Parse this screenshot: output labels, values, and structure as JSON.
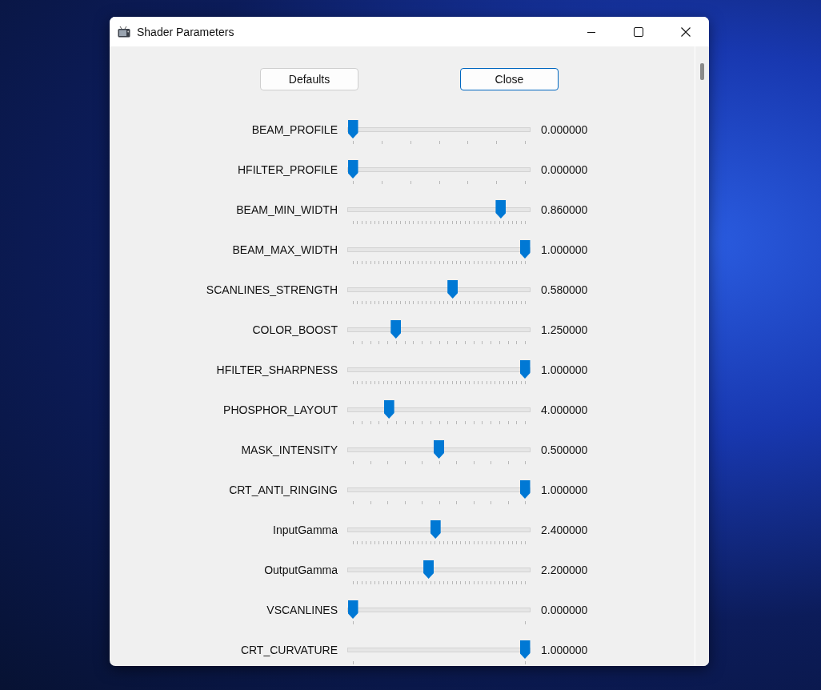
{
  "window": {
    "title": "Shader Parameters"
  },
  "buttons": [
    {
      "label": "Defaults",
      "focused": false
    },
    {
      "label": "Close",
      "focused": true
    }
  ],
  "parameters": [
    {
      "name": "BEAM_PROFILE",
      "level": 0,
      "kind": "sixths",
      "reading": "0.000000"
    },
    {
      "name": "HFILTER_PROFILE",
      "level": 0,
      "kind": "sixths",
      "reading": "0.000000"
    },
    {
      "name": "BEAM_MIN_WIDTH",
      "level": 0.86,
      "kind": "fine",
      "reading": "0.860000"
    },
    {
      "name": "BEAM_MAX_WIDTH",
      "level": 1,
      "kind": "fine",
      "reading": "1.000000"
    },
    {
      "name": "SCANLINES_STRENGTH",
      "level": 0.58,
      "kind": "fine",
      "reading": "0.580000"
    },
    {
      "name": "COLOR_BOOST",
      "level": 0.25,
      "kind": "twentieths",
      "reading": "1.250000"
    },
    {
      "name": "HFILTER_SHARPNESS",
      "level": 1,
      "kind": "fine",
      "reading": "1.000000"
    },
    {
      "name": "PHOSPHOR_LAYOUT",
      "level": 0.21,
      "kind": "twentieths",
      "reading": "4.000000"
    },
    {
      "name": "MASK_INTENSITY",
      "level": 0.5,
      "kind": "tenths",
      "reading": "0.500000"
    },
    {
      "name": "CRT_ANTI_RINGING",
      "level": 1,
      "kind": "tenths",
      "reading": "1.000000"
    },
    {
      "name": "InputGamma",
      "level": 0.48,
      "kind": "fine",
      "reading": "2.400000"
    },
    {
      "name": "OutputGamma",
      "level": 0.44,
      "kind": "fine",
      "reading": "2.200000"
    },
    {
      "name": "VSCANLINES",
      "level": 0,
      "kind": "ends",
      "reading": "0.000000"
    },
    {
      "name": "CRT_CURVATURE",
      "level": 1,
      "kind": "ends",
      "reading": "1.000000"
    }
  ]
}
